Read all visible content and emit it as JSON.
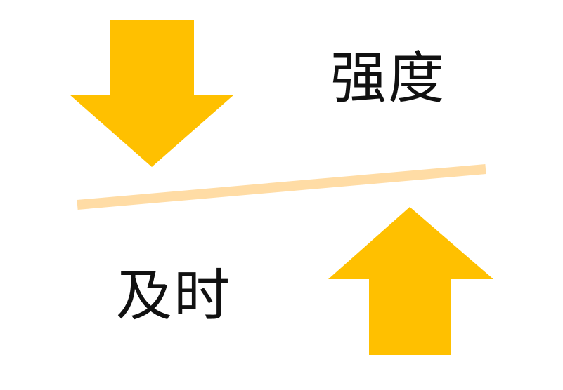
{
  "labels": {
    "intensity": "强度",
    "timely": "及时"
  },
  "icons": {
    "top_arrow": "down-arrow-icon",
    "bottom_arrow": "up-arrow-icon",
    "balance_bar": "balance-beam"
  },
  "colors": {
    "arrow": "#FFC000",
    "beam": "#FFDCA5",
    "text": "#111111",
    "background": "#FFFFFF"
  }
}
